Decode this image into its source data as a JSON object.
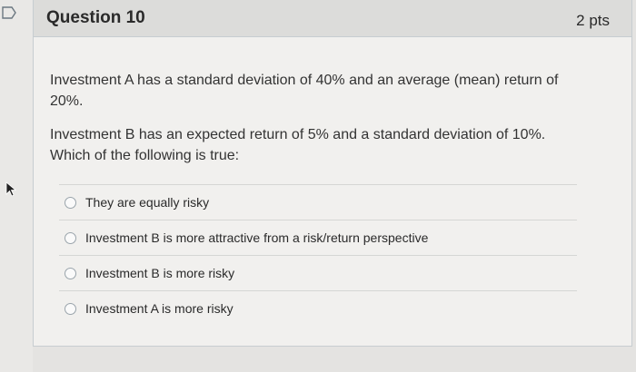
{
  "question": {
    "title": "Question 10",
    "points": "2 pts",
    "paragraphs": [
      "Investment A has a standard deviation of 40% and an average (mean) return of 20%.",
      "Investment B has an expected return of 5% and a standard deviation of 10%. Which of the following is true:"
    ],
    "answers": [
      {
        "label": "They are equally risky",
        "selected": false
      },
      {
        "label": "Investment B is more attractive from a risk/return perspective",
        "selected": false
      },
      {
        "label": "Investment B is more risky",
        "selected": false
      },
      {
        "label": "Investment A is more risky",
        "selected": false
      }
    ]
  },
  "icons": {
    "flag": "bookmark-flag-icon",
    "cursor": "mouse-pointer-icon",
    "radio": "radio-button-icon"
  },
  "colors": {
    "header_bg": "#dcdcda",
    "card_bg": "#f1f0ee",
    "text": "#2a2a2a"
  }
}
